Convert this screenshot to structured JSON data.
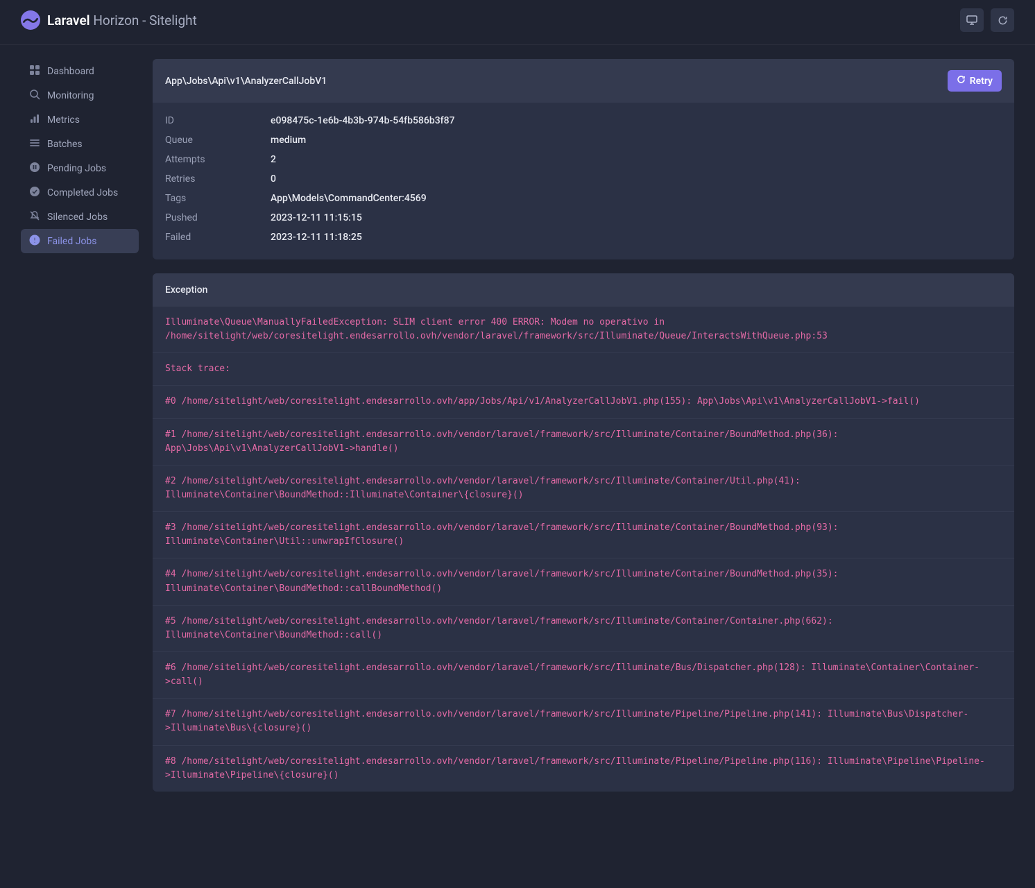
{
  "brand": {
    "bold": "Laravel",
    "rest": " Horizon - Sitelight"
  },
  "sidebar": {
    "items": [
      {
        "label": "Dashboard"
      },
      {
        "label": "Monitoring"
      },
      {
        "label": "Metrics"
      },
      {
        "label": "Batches"
      },
      {
        "label": "Pending Jobs"
      },
      {
        "label": "Completed Jobs"
      },
      {
        "label": "Silenced Jobs"
      },
      {
        "label": "Failed Jobs"
      }
    ],
    "activeIndex": 7
  },
  "job": {
    "title": "App\\Jobs\\Api\\v1\\AnalyzerCallJobV1",
    "retry_label": "Retry",
    "details": [
      {
        "label": "ID",
        "value": "e098475c-1e6b-4b3b-974b-54fb586b3f87"
      },
      {
        "label": "Queue",
        "value": "medium"
      },
      {
        "label": "Attempts",
        "value": "2"
      },
      {
        "label": "Retries",
        "value": "0"
      },
      {
        "label": "Tags",
        "value": "App\\Models\\CommandCenter:4569"
      },
      {
        "label": "Pushed",
        "value": "2023-12-11 11:15:15"
      },
      {
        "label": "Failed",
        "value": "2023-12-11 11:18:25"
      }
    ]
  },
  "exception": {
    "title": "Exception",
    "lines": [
      "Illuminate\\Queue\\ManuallyFailedException: SLIM client error 400 ERROR: Modem no operativo in /home/sitelight/web/coresitelight.endesarrollo.ovh/vendor/laravel/framework/src/Illuminate/Queue/InteractsWithQueue.php:53",
      "Stack trace:",
      "#0 /home/sitelight/web/coresitelight.endesarrollo.ovh/app/Jobs/Api/v1/AnalyzerCallJobV1.php(155): App\\Jobs\\Api\\v1\\AnalyzerCallJobV1->fail()",
      "#1 /home/sitelight/web/coresitelight.endesarrollo.ovh/vendor/laravel/framework/src/Illuminate/Container/BoundMethod.php(36): App\\Jobs\\Api\\v1\\AnalyzerCallJobV1->handle()",
      "#2 /home/sitelight/web/coresitelight.endesarrollo.ovh/vendor/laravel/framework/src/Illuminate/Container/Util.php(41): Illuminate\\Container\\BoundMethod::Illuminate\\Container\\{closure}()",
      "#3 /home/sitelight/web/coresitelight.endesarrollo.ovh/vendor/laravel/framework/src/Illuminate/Container/BoundMethod.php(93): Illuminate\\Container\\Util::unwrapIfClosure()",
      "#4 /home/sitelight/web/coresitelight.endesarrollo.ovh/vendor/laravel/framework/src/Illuminate/Container/BoundMethod.php(35): Illuminate\\Container\\BoundMethod::callBoundMethod()",
      "#5 /home/sitelight/web/coresitelight.endesarrollo.ovh/vendor/laravel/framework/src/Illuminate/Container/Container.php(662): Illuminate\\Container\\BoundMethod::call()",
      "#6 /home/sitelight/web/coresitelight.endesarrollo.ovh/vendor/laravel/framework/src/Illuminate/Bus/Dispatcher.php(128): Illuminate\\Container\\Container->call()",
      "#7 /home/sitelight/web/coresitelight.endesarrollo.ovh/vendor/laravel/framework/src/Illuminate/Pipeline/Pipeline.php(141): Illuminate\\Bus\\Dispatcher->Illuminate\\Bus\\{closure}()",
      "#8 /home/sitelight/web/coresitelight.endesarrollo.ovh/vendor/laravel/framework/src/Illuminate/Pipeline/Pipeline.php(116): Illuminate\\Pipeline\\Pipeline->Illuminate\\Pipeline\\{closure}()"
    ]
  }
}
